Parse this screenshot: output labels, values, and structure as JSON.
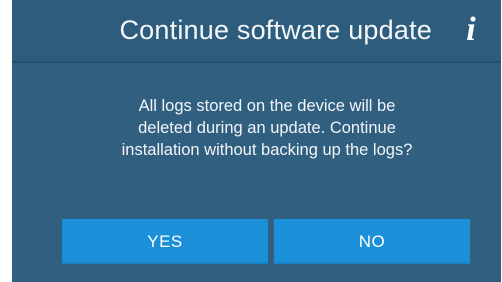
{
  "dialog": {
    "title": "Continue software update",
    "info_icon": "info-icon",
    "message_lines": [
      "All logs stored on the device will be",
      "deleted during an update. Continue",
      "installation without backing up the logs?"
    ],
    "buttons": {
      "yes_label": "YES",
      "no_label": "NO"
    }
  },
  "colors": {
    "background": "#315f80",
    "title_bar": "#2e5c7c",
    "button": "#1b8fd8",
    "text": "#f2f6f9"
  }
}
